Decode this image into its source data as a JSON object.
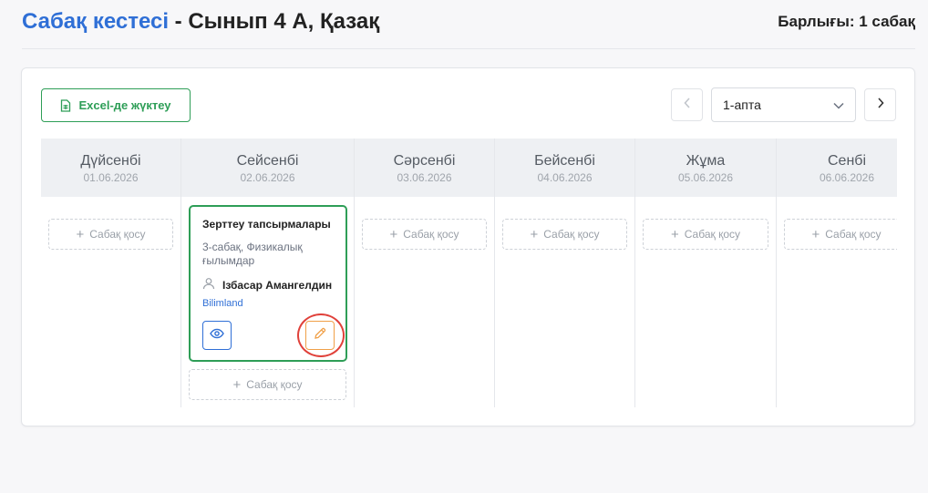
{
  "header": {
    "title_accent": "Сабақ кестесі",
    "title_rest": " - Сынып 4 А, Қазақ",
    "total": "Барлығы: 1 сабақ"
  },
  "toolbar": {
    "excel_label": "Excel-де жүктеу",
    "week_value": "1-апта"
  },
  "days": [
    {
      "name": "Дүйсенбі",
      "date": "01.06.2026"
    },
    {
      "name": "Сейсенбі",
      "date": "02.06.2026"
    },
    {
      "name": "Сәрсенбі",
      "date": "03.06.2026"
    },
    {
      "name": "Бейсенбі",
      "date": "04.06.2026"
    },
    {
      "name": "Жұма",
      "date": "05.06.2026"
    },
    {
      "name": "Сенбі",
      "date": "06.06.2026"
    }
  ],
  "add_label": "Сабақ қосу",
  "lesson": {
    "title": "Зерттеу тапсырмалары",
    "subtitle": "3-сабақ, Физикалық ғылымдар",
    "teacher": "Ізбасар Амангелдин",
    "platform": "Bilimland"
  },
  "icons": {
    "excel": "spreadsheet-icon",
    "prev": "chevron-left-icon",
    "next": "chevron-right-icon",
    "dropdown": "chevron-down-icon",
    "plus": "plus-icon",
    "user": "user-icon",
    "view": "eye-icon",
    "edit": "pencil-icon"
  },
  "colors": {
    "accent": "#2f6fd6",
    "success": "#2e9e57",
    "edit": "#f0a048",
    "highlight": "#e0413a"
  }
}
